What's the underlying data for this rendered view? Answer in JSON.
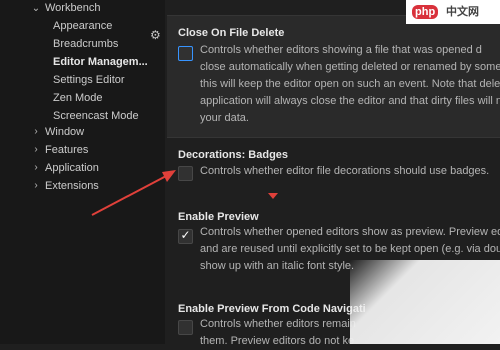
{
  "tree": {
    "workbench": "Workbench",
    "items": [
      {
        "label": "Appearance"
      },
      {
        "label": "Breadcrumbs"
      },
      {
        "label": "Editor Managem..."
      },
      {
        "label": "Settings Editor"
      },
      {
        "label": "Zen Mode"
      },
      {
        "label": "Screencast Mode"
      }
    ],
    "groups": [
      {
        "label": "Window"
      },
      {
        "label": "Features"
      },
      {
        "label": "Application"
      },
      {
        "label": "Extensions"
      }
    ]
  },
  "settings": {
    "close_on_delete": {
      "title": "Close On File Delete",
      "lines": [
        "Controls whether editors showing a file that was opened d",
        "close automatically when getting deleted or renamed by some of",
        "this will keep the editor open on such an event. Note that deletin",
        "application will always close the editor and that dirty files will nev",
        "your data."
      ]
    },
    "decorations": {
      "title": "Decorations: Badges",
      "desc": "Controls whether editor file decorations should use badges."
    },
    "enable_preview": {
      "title": "Enable Preview",
      "lines": [
        "Controls whether opened editors show as preview. Preview editor",
        "and are reused until explicitly set to be kept open (e.g. via double",
        "show up with an italic font style."
      ]
    },
    "preview_code_nav": {
      "title": "Enable Preview From Code Navigati",
      "lines": [
        "Controls whether editors remain",
        "them. Preview editors do not ke"
      ]
    }
  },
  "watermark": {
    "logo": "php",
    "text": "中文网"
  },
  "colors": {
    "accent": "#3794ff",
    "arrow": "#e0403a"
  }
}
